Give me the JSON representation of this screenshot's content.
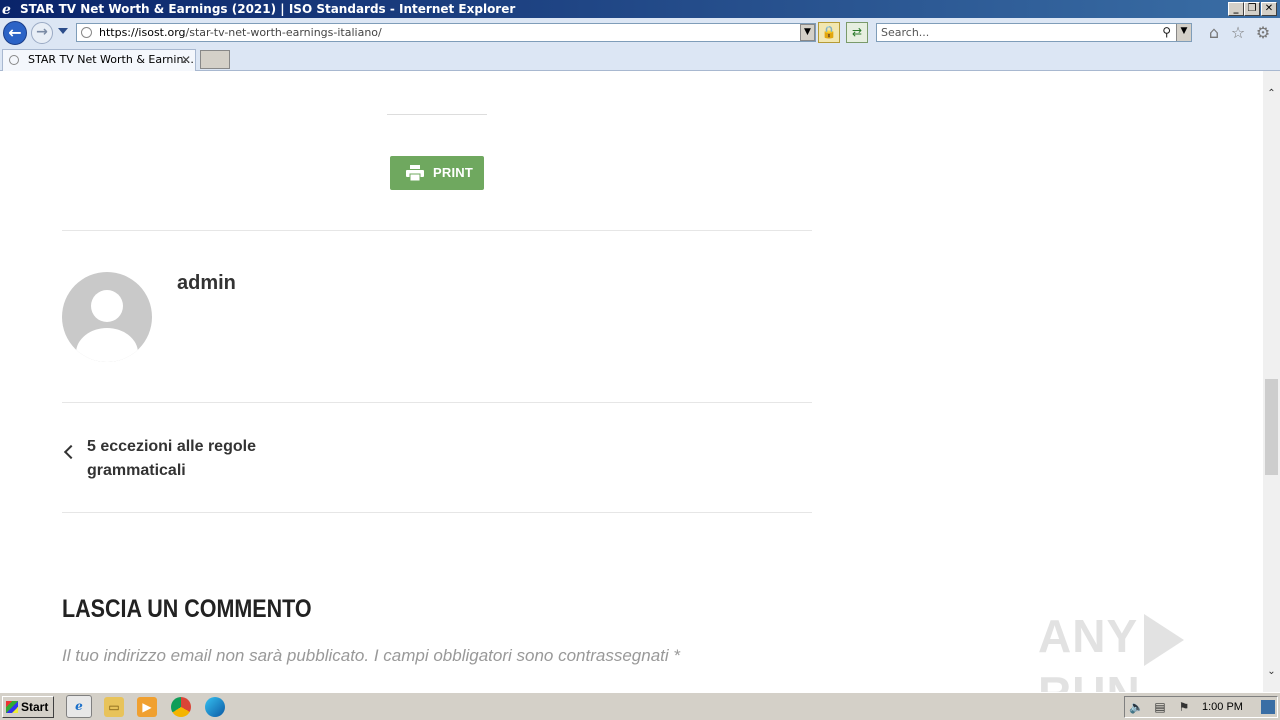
{
  "window": {
    "title": "STAR TV Net Worth & Earnings (2021) | ISO Standards - Internet Explorer",
    "minimize": "_",
    "restore": "❐",
    "close": "✕"
  },
  "address_bar": {
    "host": "https://isost.org",
    "path": "/star-tv-net-worth-earnings-italiano/",
    "search_placeholder": "Search..."
  },
  "tabs": [
    {
      "label": "STAR TV Net Worth & Earnin..."
    }
  ],
  "page": {
    "print_label": "PRINT",
    "author_name": "admin",
    "prev_post_title": "5 eccezioni alle regole grammaticali",
    "comment_heading": "LASCIA UN COMMENTO",
    "comment_notes": "Il tuo indirizzo email non sarà pubblicato. I campi obbligatori sono contrassegnati",
    "required_mark": "*",
    "watermark_left": "ANY",
    "watermark_right": "RUN"
  },
  "taskbar": {
    "start_label": "Start",
    "clock": "1:00 PM"
  },
  "colors": {
    "print_button": "#6fa85f",
    "titlebar": "#0a246a",
    "taskbar": "#d4d0c8"
  }
}
